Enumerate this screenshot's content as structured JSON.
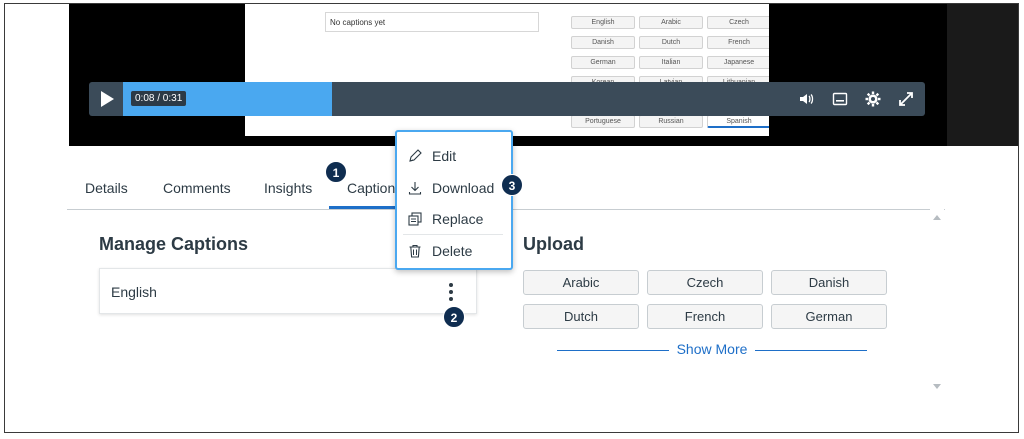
{
  "video": {
    "caption_placeholder": "No captions yet",
    "languages": [
      [
        "English",
        "Arabic",
        "Czech"
      ],
      [
        "Danish",
        "Dutch",
        "French"
      ],
      [
        "German",
        "Italian",
        "Japanese"
      ],
      [
        "Korean",
        "Latvian",
        "Lithuanian"
      ],
      [
        "Portuguese",
        "Russian",
        "Spanish"
      ]
    ],
    "time_readout": "0:08 / 0:31",
    "progress_fraction": 0.26
  },
  "tabs": [
    {
      "label": "Details"
    },
    {
      "label": "Comments"
    },
    {
      "label": "Insights"
    },
    {
      "label": "Captions"
    }
  ],
  "manage": {
    "title": "Manage Captions",
    "caption_language": "English"
  },
  "upload": {
    "title": "Upload",
    "languages": [
      "Arabic",
      "Czech",
      "Danish",
      "Dutch",
      "French",
      "German"
    ],
    "show_more": "Show More"
  },
  "menu": {
    "items": [
      {
        "label": "Edit",
        "icon": "pencil-icon"
      },
      {
        "label": "Download",
        "icon": "download-icon"
      },
      {
        "label": "Replace",
        "icon": "replace-icon"
      },
      {
        "label": "Delete",
        "icon": "trash-icon"
      }
    ]
  },
  "badges": [
    "1",
    "2",
    "3"
  ],
  "colors": {
    "accent": "#1e6fc8",
    "progress": "#4aa8f0",
    "badge": "#0f2d50",
    "control_bar": "#3b4b59"
  }
}
